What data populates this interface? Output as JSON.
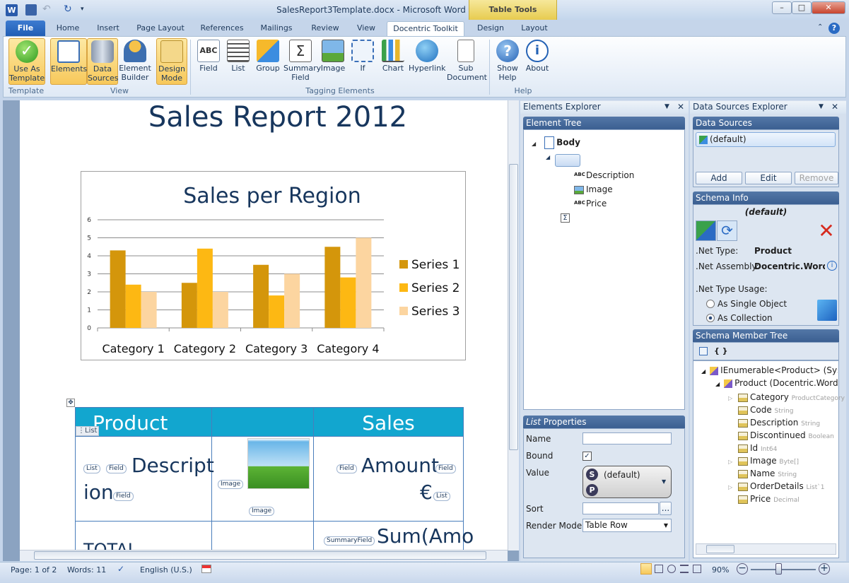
{
  "window": {
    "title": "SalesReport3Template.docx - Microsoft Word",
    "table_tools": "Table Tools"
  },
  "tabs": {
    "file": "File",
    "items": [
      "Home",
      "Insert",
      "Page Layout",
      "References",
      "Mailings",
      "Review",
      "View",
      "Docentric Toolkit",
      "Design",
      "Layout"
    ],
    "active": "Docentric Toolkit"
  },
  "ribbon": {
    "buttons": [
      {
        "label": "Use As Template",
        "icon": "checkmark-icon"
      },
      {
        "label": "Elements",
        "icon": "elements-tree-icon"
      },
      {
        "label": "Data Sources",
        "icon": "database-icon"
      },
      {
        "label": "Element Builder",
        "icon": "builder-person-icon"
      },
      {
        "label": "Design Mode",
        "icon": "design-triangle-icon"
      },
      {
        "label": "Field",
        "icon": "abc-field-icon"
      },
      {
        "label": "List",
        "icon": "list-icon"
      },
      {
        "label": "Group",
        "icon": "group-icon"
      },
      {
        "label": "Summary Field",
        "icon": "sigma-icon"
      },
      {
        "label": "Image",
        "icon": "image-icon"
      },
      {
        "label": "If",
        "icon": "if-icon"
      },
      {
        "label": "Chart",
        "icon": "chart-icon"
      },
      {
        "label": "Hyperlink",
        "icon": "globe-icon"
      },
      {
        "label": "Sub Document",
        "icon": "document-icon"
      },
      {
        "label": "Show Help",
        "icon": "help-icon"
      },
      {
        "label": "About",
        "icon": "info-icon"
      }
    ],
    "groups": [
      "Template",
      "View",
      "Tagging Elements",
      "Help"
    ]
  },
  "document": {
    "title": "Sales Report 2012",
    "table": {
      "headers": [
        "Product",
        "",
        "Sales"
      ],
      "list_tag": "List",
      "row1": {
        "tags_left": [
          "List",
          "Field"
        ],
        "desc_a": "Descript",
        "desc_b": "ion",
        "tag_field_after": "Field",
        "image_tag": "Image",
        "image_tag2": "Image",
        "amount_tag": "Field",
        "amount": "Amount",
        "amount_tag2": "Field",
        "euro": "€",
        "list_end": "List"
      },
      "row2": {
        "total": "TOTAL",
        "summary_tag": "SummaryField",
        "sum": "Sum(Amo"
      }
    }
  },
  "chart_data": {
    "type": "bar",
    "title": "Sales per Region",
    "categories": [
      "Category 1",
      "Category 2",
      "Category 3",
      "Category 4"
    ],
    "series": [
      {
        "name": "Series 1",
        "values": [
          4.3,
          2.5,
          3.5,
          4.5
        ],
        "color": "#d4960b"
      },
      {
        "name": "Series 2",
        "values": [
          2.4,
          4.4,
          1.8,
          2.8
        ],
        "color": "#fdb813"
      },
      {
        "name": "Series 3",
        "values": [
          2.0,
          2.0,
          3.0,
          5.0
        ],
        "color": "#fcd5a0"
      }
    ],
    "ylim": [
      0,
      6
    ],
    "yticks": [
      "0",
      "1",
      "2",
      "3",
      "4",
      "5",
      "6"
    ],
    "grid": true,
    "legend": "right"
  },
  "elements_explorer": {
    "title": "Elements Explorer",
    "section": "Element Tree",
    "nodes": {
      "body": "Body",
      "description": "Description",
      "image": "Image",
      "price": "Price"
    }
  },
  "list_properties": {
    "title_em": "List",
    "title_rest": " Properties",
    "name_label": "Name",
    "bound_label": "Bound",
    "value_label": "Value",
    "value_default": "(default)",
    "sort_label": "Sort",
    "sort_btn": "...",
    "render_label": "Render Mode",
    "render_value": "Table Row"
  },
  "data_sources": {
    "title": "Data Sources Explorer",
    "section": "Data Sources",
    "item": "(default)",
    "add": "Add",
    "edit": "Edit",
    "remove": "Remove",
    "schema_info": "Schema Info",
    "schema_name": "(default)",
    "net_type_label": ".Net Type:",
    "net_type_value": "Product",
    "net_assembly_label": ".Net Assembly:",
    "net_assembly_value": "Docentric.Word.Exa",
    "usage_label": ".Net Type Usage:",
    "usage_single": "As Single Object",
    "usage_collection": "As Collection",
    "member_tree": "Schema Member Tree",
    "braces": "{ }",
    "root": "IEnumerable<Product> (System",
    "product": "Product (Docentric.Word.Ex",
    "members": [
      {
        "name": "Category",
        "type": "ProductCategory"
      },
      {
        "name": "Code",
        "type": "String"
      },
      {
        "name": "Description",
        "type": "String"
      },
      {
        "name": "Discontinued",
        "type": "Boolean"
      },
      {
        "name": "Id",
        "type": "Int64"
      },
      {
        "name": "Image",
        "type": "Byte[]"
      },
      {
        "name": "Name",
        "type": "String"
      },
      {
        "name": "OrderDetails",
        "type": "List`1"
      },
      {
        "name": "Price",
        "type": "Decimal"
      }
    ]
  },
  "status": {
    "page": "Page: 1 of 2",
    "words": "Words: 11",
    "language": "English (U.S.)",
    "zoom": "90%"
  }
}
